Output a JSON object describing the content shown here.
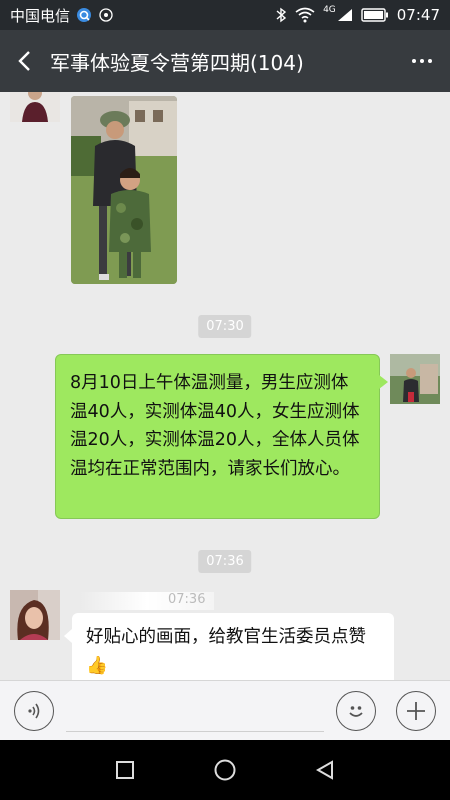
{
  "status_bar": {
    "carrier": "中国电信",
    "network": "4G",
    "time": "07:47"
  },
  "header": {
    "title": "军事体验夏令营第四期(104)"
  },
  "messages": {
    "timestamp1": "07:30",
    "outgoing_text": "8月10日上午体温测量，男生应测体温40人，实测体温40人，女生应测体温20人，实测体温20人，全体人员体温均在正常范围内，请家长们放心。",
    "timestamp2": "07:36",
    "quoted_time": "07:36",
    "incoming_text": "好贴心的画面，给教官生活委员点赞👍"
  },
  "colors": {
    "outgoing_bubble": "#9ee85f",
    "title_bar": "#373b3f",
    "status_bar": "#262a2e"
  },
  "icons": {
    "back": "back-arrow-icon",
    "more": "more-dots-icon",
    "voice": "voice-icon",
    "emoji": "emoji-icon",
    "plus": "plus-icon"
  }
}
